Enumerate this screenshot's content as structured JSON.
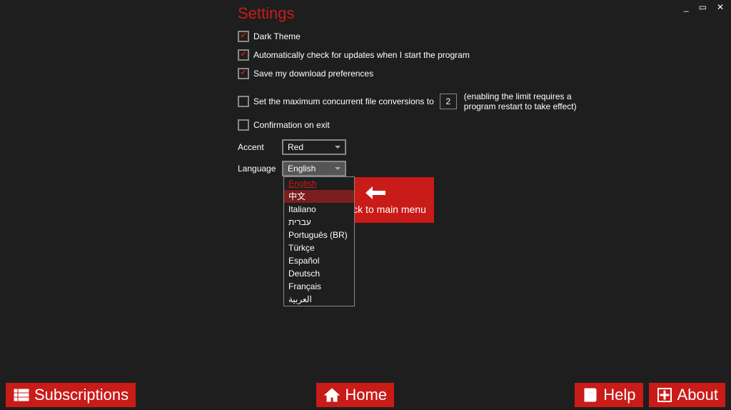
{
  "title": "Settings",
  "checkboxes": {
    "dark_theme": {
      "label": "Dark Theme",
      "checked": true
    },
    "auto_update": {
      "label": "Automatically check for updates when I start the program",
      "checked": true
    },
    "save_prefs": {
      "label": "Save my download preferences",
      "checked": true
    },
    "max_conv": {
      "label": "Set the maximum concurrent file conversions to",
      "checked": false,
      "value": "2",
      "hint_line1": "(enabling the limit requires a",
      "hint_line2": "program restart to take effect)"
    },
    "confirm_exit": {
      "label": "Confirmation on exit",
      "checked": false
    }
  },
  "accent": {
    "label": "Accent",
    "value": "Red"
  },
  "language": {
    "label": "Language",
    "value": "English",
    "options": [
      "English",
      "中文",
      "Italiano",
      "עברית",
      "Português (BR)",
      "Türkçe",
      "Español",
      "Deutsch",
      "Français",
      "العربية"
    ],
    "hover_index": 1,
    "active_index": 0
  },
  "save_button": {
    "label": "Save and back to main menu",
    "visible_text": "nd back to main menu"
  },
  "bottom": {
    "subscriptions": "Subscriptions",
    "home": "Home",
    "help": "Help",
    "about": "About"
  },
  "window": {
    "minimize": "_",
    "maximize": "▭",
    "close": "✕"
  }
}
